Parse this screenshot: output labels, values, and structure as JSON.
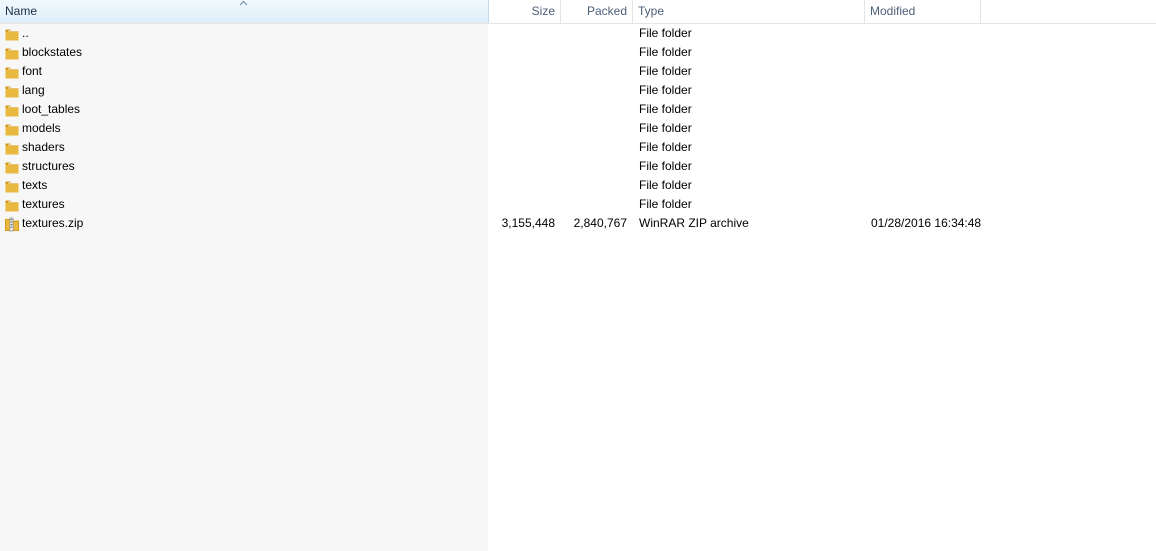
{
  "columns": {
    "name": "Name",
    "size": "Size",
    "packed": "Packed",
    "type": "Type",
    "modified": "Modified"
  },
  "sort": {
    "column": "name",
    "direction": "ascending",
    "icon": "sort-up-arrow-icon"
  },
  "colors": {
    "folder_icon": "#e8b93e",
    "folder_icon_shade": "#d49a1c",
    "header_text": "#4c607a",
    "sorted_header_bg": "#dceef9",
    "name_column_bg": "#f7f7f7"
  },
  "rows": [
    {
      "icon": "parent-folder-icon",
      "name": "..",
      "size": "",
      "packed": "",
      "type": "File folder",
      "modified": ""
    },
    {
      "icon": "folder-icon",
      "name": "blockstates",
      "size": "",
      "packed": "",
      "type": "File folder",
      "modified": ""
    },
    {
      "icon": "folder-icon",
      "name": "font",
      "size": "",
      "packed": "",
      "type": "File folder",
      "modified": ""
    },
    {
      "icon": "folder-icon",
      "name": "lang",
      "size": "",
      "packed": "",
      "type": "File folder",
      "modified": ""
    },
    {
      "icon": "folder-icon",
      "name": "loot_tables",
      "size": "",
      "packed": "",
      "type": "File folder",
      "modified": ""
    },
    {
      "icon": "folder-icon",
      "name": "models",
      "size": "",
      "packed": "",
      "type": "File folder",
      "modified": ""
    },
    {
      "icon": "folder-icon",
      "name": "shaders",
      "size": "",
      "packed": "",
      "type": "File folder",
      "modified": ""
    },
    {
      "icon": "folder-icon",
      "name": "structures",
      "size": "",
      "packed": "",
      "type": "File folder",
      "modified": ""
    },
    {
      "icon": "folder-icon",
      "name": "texts",
      "size": "",
      "packed": "",
      "type": "File folder",
      "modified": ""
    },
    {
      "icon": "folder-icon",
      "name": "textures",
      "size": "",
      "packed": "",
      "type": "File folder",
      "modified": ""
    },
    {
      "icon": "zip-archive-icon",
      "name": "textures.zip",
      "size": "3,155,448",
      "packed": "2,840,767",
      "type": "WinRAR ZIP archive",
      "modified": "01/28/2016 16:34:48"
    }
  ]
}
